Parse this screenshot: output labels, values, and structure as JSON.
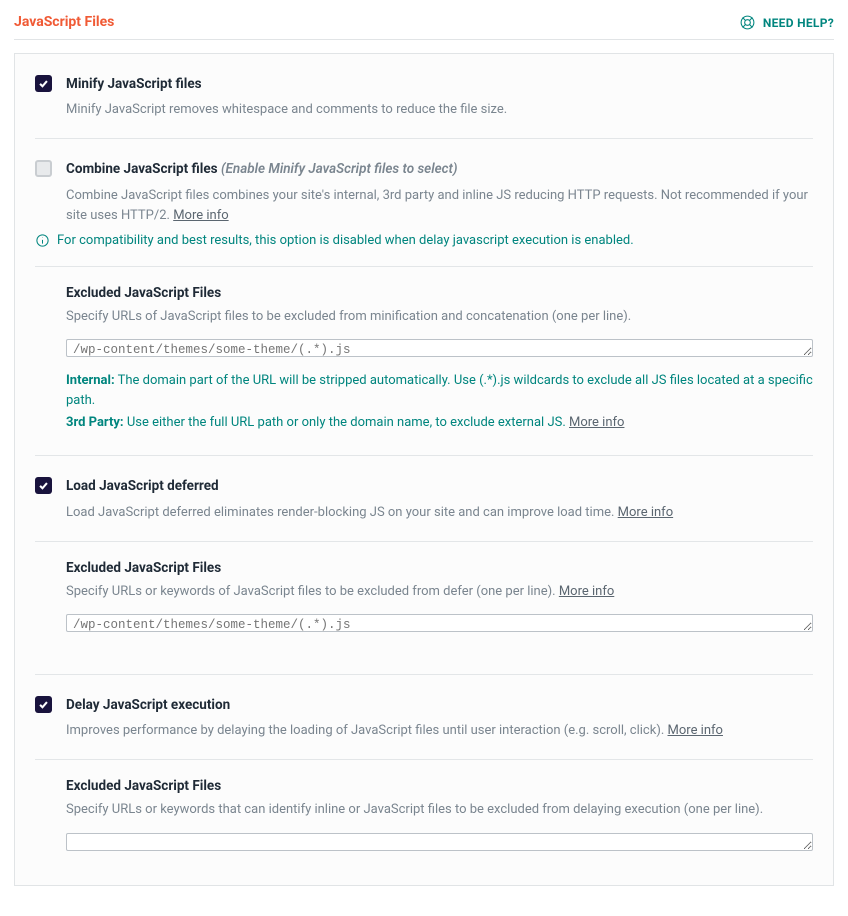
{
  "header": {
    "title": "JavaScript Files",
    "help": "NEED HELP?"
  },
  "options": {
    "minify": {
      "title": "Minify JavaScript files",
      "desc": "Minify JavaScript removes whitespace and comments to reduce the file size."
    },
    "combine": {
      "title": "Combine JavaScript files",
      "hint": "(Enable Minify JavaScript files to select)",
      "desc": "Combine JavaScript files combines your site's internal, 3rd party and inline JS reducing HTTP requests. Not recommended if your site uses HTTP/2.",
      "more": "More info",
      "compat": "For compatibility and best results, this option is disabled when delay javascript execution is enabled."
    },
    "excluded1": {
      "title": "Excluded JavaScript Files",
      "desc": "Specify URLs of JavaScript files to be excluded from minification and concatenation (one per line).",
      "placeholder": "/wp-content/themes/some-theme/(.*).js",
      "internal_label": "Internal:",
      "internal_text": "The domain part of the URL will be stripped automatically. Use (.*).js wildcards to exclude all JS files located at a specific path.",
      "third_label": "3rd Party:",
      "third_text": "Use either the full URL path or only the domain name, to exclude external JS.",
      "more": "More info"
    },
    "defer": {
      "title": "Load JavaScript deferred",
      "desc": "Load JavaScript deferred eliminates render-blocking JS on your site and can improve load time.",
      "more": "More info"
    },
    "excluded2": {
      "title": "Excluded JavaScript Files",
      "desc": "Specify URLs or keywords of JavaScript files to be excluded from defer (one per line).",
      "more": "More info",
      "placeholder": "/wp-content/themes/some-theme/(.*).js"
    },
    "delay": {
      "title": "Delay JavaScript execution",
      "desc": "Improves performance by delaying the loading of JavaScript files until user interaction (e.g. scroll, click).",
      "more": "More info"
    },
    "excluded3": {
      "title": "Excluded JavaScript Files",
      "desc": "Specify URLs or keywords that can identify inline or JavaScript files to be excluded from delaying execution (one per line)."
    }
  }
}
